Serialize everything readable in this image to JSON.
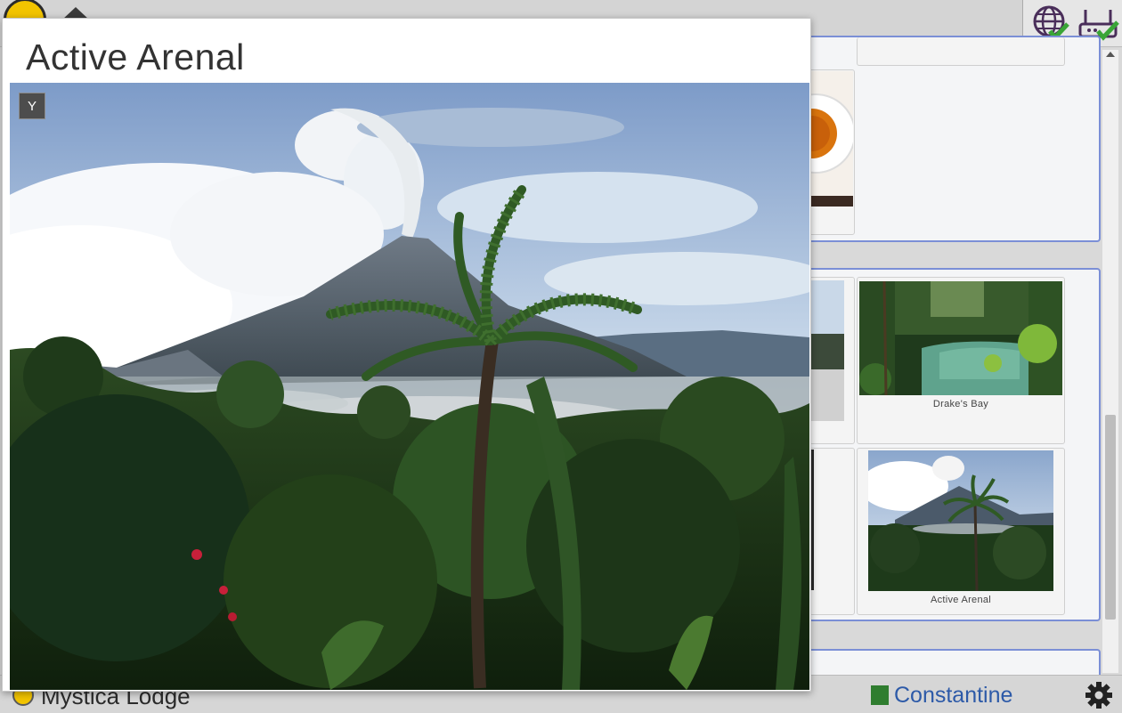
{
  "header": {
    "logo_icon": "owl-logo-icon",
    "home_icon": "home-icon",
    "status_icons": [
      "globe-check-icon",
      "router-check-icon"
    ],
    "status_color": "#3aa537"
  },
  "gallery": {
    "items": [
      {
        "caption": "Drake's Bay"
      },
      {
        "caption": "Active Arenal"
      }
    ]
  },
  "footer": {
    "lodge_name": "Mystica Lodge",
    "user_name": "Constantine",
    "settings_icon": "gear-icon"
  },
  "modal": {
    "title": "Active Arenal",
    "close_label": "Y",
    "image_description_icon": "volcano-photo"
  },
  "colors": {
    "panel_border": "#7b8fd6",
    "user_text": "#2d5aa8",
    "logo_yellow": "#f2c400"
  }
}
